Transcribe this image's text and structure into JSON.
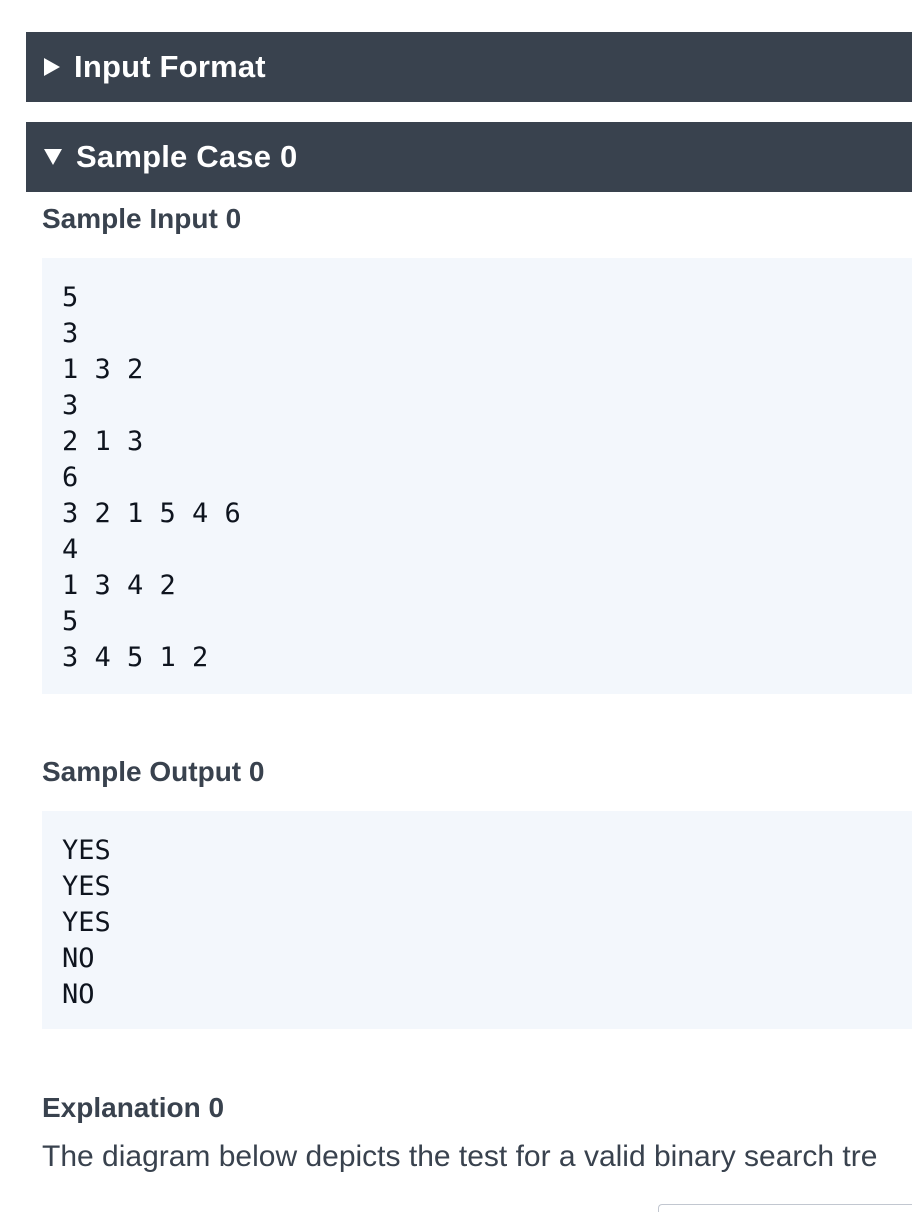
{
  "sections": {
    "input_format": {
      "label": "Input Format",
      "icon": "triangle-right-icon",
      "expanded": false
    },
    "sample_case": {
      "label": "Sample Case 0",
      "icon": "triangle-down-icon",
      "expanded": true
    }
  },
  "sample_input": {
    "heading": "Sample Input 0",
    "lines": [
      "5",
      "3",
      "1 3 2",
      "3",
      "2 1 3",
      "6",
      "3 2 1 5 4 6",
      "4",
      "1 3 4 2",
      "5",
      "3 4 5 1 2"
    ]
  },
  "sample_output": {
    "heading": "Sample Output 0",
    "lines": [
      "YES",
      "YES",
      "YES",
      "NO",
      "NO"
    ]
  },
  "explanation": {
    "heading": "Explanation 0",
    "text": "The diagram below depicts the test for a valid binary search tre"
  },
  "colors": {
    "header_bg": "#39424e",
    "code_bg": "#f3f7fc",
    "text": "#39424e"
  }
}
